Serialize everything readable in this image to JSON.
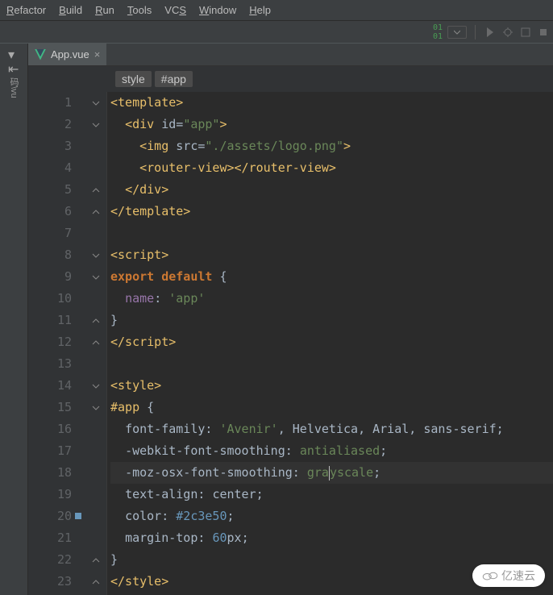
{
  "menu": {
    "items": [
      {
        "label": "Refactor",
        "u": 0
      },
      {
        "label": "Build",
        "u": 0
      },
      {
        "label": "Run",
        "u": 0
      },
      {
        "label": "Tools",
        "u": 0
      },
      {
        "label": "VCS",
        "u": 2
      },
      {
        "label": "Window",
        "u": 0
      },
      {
        "label": "Help",
        "u": 0
      }
    ]
  },
  "tab": {
    "filename": "App.vue"
  },
  "breadcrumbs": [
    "style",
    "#app"
  ],
  "sidebar_label": "码\\vu",
  "code": {
    "lines": [
      {
        "n": 1,
        "fold": "open",
        "html": "<span class='c-tag'>&lt;template&gt;</span>"
      },
      {
        "n": 2,
        "fold": "open",
        "html": "  <span class='c-tag'>&lt;div</span> <span class='c-attr'>id=</span><span class='c-str'>\"app\"</span><span class='c-tag'>&gt;</span>"
      },
      {
        "n": 3,
        "html": "    <span class='c-tag'>&lt;img</span> <span class='c-attr'>src=</span><span class='c-str'>\"./assets/logo.png\"</span><span class='c-tag'>&gt;</span>"
      },
      {
        "n": 4,
        "html": "    <span class='c-tag'>&lt;router-view&gt;&lt;/router-view&gt;</span>"
      },
      {
        "n": 5,
        "fold": "close",
        "html": "  <span class='c-tag'>&lt;/div&gt;</span>"
      },
      {
        "n": 6,
        "fold": "close",
        "html": "<span class='c-tag'>&lt;/template&gt;</span>"
      },
      {
        "n": 7,
        "html": ""
      },
      {
        "n": 8,
        "fold": "open",
        "html": "<span class='c-tag'>&lt;script&gt;</span>"
      },
      {
        "n": 9,
        "fold": "open",
        "html": "<span class='c-kw'>export default</span> {"
      },
      {
        "n": 10,
        "html": "  <span class='c-prop'>name</span>: <span class='c-str'>'app'</span>"
      },
      {
        "n": 11,
        "fold": "close",
        "html": "}"
      },
      {
        "n": 12,
        "fold": "close",
        "html": "<span class='c-tag'>&lt;/script&gt;</span>"
      },
      {
        "n": 13,
        "html": ""
      },
      {
        "n": 14,
        "fold": "open",
        "html": "<span class='c-tag'>&lt;style&gt;</span>"
      },
      {
        "n": 15,
        "fold": "open",
        "html": "<span class='c-sel'>#app</span> {"
      },
      {
        "n": 16,
        "html": "  <span class='c-val'>font-family</span>: <span class='c-str'>'Avenir'</span>, <span class='c-font'>Helvetica</span>, <span class='c-font'>Arial</span>, <span class='c-font'>sans-serif</span>;"
      },
      {
        "n": 17,
        "html": "  <span class='c-val'>-webkit-font-smoothing</span>: <span class='c-green'>antialiased</span>;"
      },
      {
        "n": 18,
        "cursor": true,
        "html": "  <span class='c-val'>-moz-osx-font-smoothing</span>: <span class='c-green'>gra</span><span class='caret'></span><span class='c-green'>yscale</span>;"
      },
      {
        "n": 19,
        "html": "  <span class='c-val'>text-align</span>: <span class='c-font'>center</span>;"
      },
      {
        "n": 20,
        "bm": true,
        "html": "  <span class='c-val'>color</span>: <span class='c-hex'>#2c3e50</span>;"
      },
      {
        "n": 21,
        "html": "  <span class='c-val'>margin-top</span>: <span class='c-num'>60</span><span class='c-font'>px</span>;"
      },
      {
        "n": 22,
        "fold": "close",
        "html": "}"
      },
      {
        "n": 23,
        "fold": "close",
        "html": "<span class='c-tag'>&lt;/style&gt;</span>"
      }
    ]
  },
  "watermark": "亿速云"
}
